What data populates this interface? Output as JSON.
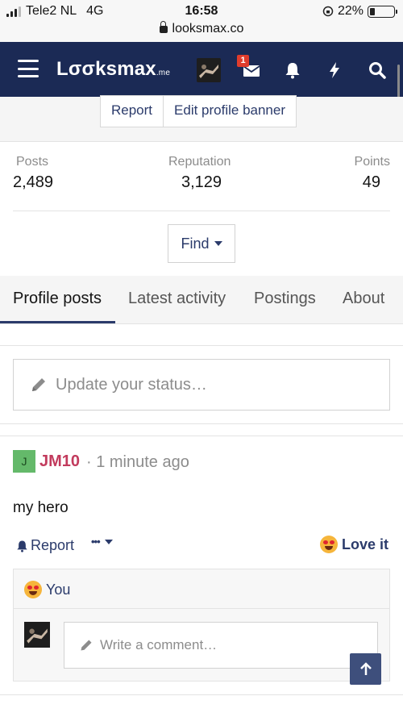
{
  "status_bar": {
    "carrier": "Tele2 NL",
    "network": "4G",
    "time": "16:58",
    "battery": "22%",
    "url": "looksmax.co"
  },
  "nav": {
    "logo_main": "Lσσksmax",
    "logo_suffix": ".me",
    "notification_count": "1",
    "colors": {
      "bar": "#1b2a55",
      "badge": "#e03c2c"
    }
  },
  "profile": {
    "report_label": "Report",
    "edit_banner_label": "Edit profile banner",
    "stats": [
      {
        "label": "Posts",
        "value": "2,489"
      },
      {
        "label": "Reputation",
        "value": "3,129"
      },
      {
        "label": "Points",
        "value": "49"
      }
    ],
    "find_label": "Find"
  },
  "tabs": [
    "Profile posts",
    "Latest activity",
    "Postings",
    "About"
  ],
  "status_update": {
    "placeholder": "Update your status…"
  },
  "post": {
    "avatar_letter": "J",
    "username": "JM10",
    "time": "· 1 minute ago",
    "body": "my hero",
    "report_label": "Report",
    "more_label": "•••",
    "love_label": "Love it",
    "reaction_user": "You",
    "comment_placeholder": "Write a comment…"
  }
}
